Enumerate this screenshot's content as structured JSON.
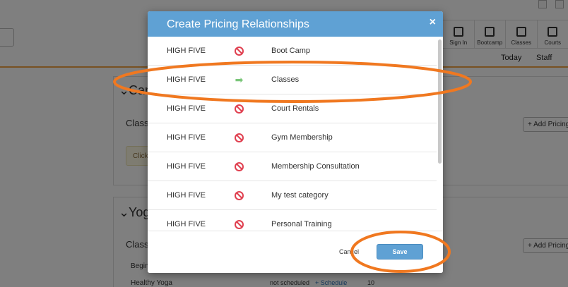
{
  "background": {
    "toolbar": [
      {
        "label": "Sign In",
        "icon": "person-icon"
      },
      {
        "label": "Bootcamp",
        "icon": "calendar-icon"
      },
      {
        "label": "Classes",
        "icon": "calendar-icon"
      },
      {
        "label": "Courts",
        "icon": "calendar-icon"
      }
    ],
    "nav": {
      "today": "Today",
      "staff": "Staff"
    },
    "panel1": {
      "title": "Cam",
      "section": "Class",
      "add_button": "+ Add Pricing",
      "notice": "Click"
    },
    "panel2": {
      "title": "Yog",
      "section": "Class",
      "add_button": "+ Add Pricing",
      "rows": [
        {
          "name": "Begin"
        },
        {
          "name": "Healthy Yoga",
          "status": "not scheduled",
          "action": "+ Schedule",
          "count": "10"
        }
      ]
    }
  },
  "modal": {
    "title": "Create Pricing Relationships",
    "close_label": "×",
    "items": [
      {
        "pricing": "HIGH FIVE",
        "status": "none",
        "category": "Boot Camp"
      },
      {
        "pricing": "HIGH FIVE",
        "status": "linked",
        "category": "Classes"
      },
      {
        "pricing": "HIGH FIVE",
        "status": "none",
        "category": "Court Rentals"
      },
      {
        "pricing": "HIGH FIVE",
        "status": "none",
        "category": "Gym Membership"
      },
      {
        "pricing": "HIGH FIVE",
        "status": "none",
        "category": "Membership Consultation"
      },
      {
        "pricing": "HIGH FIVE",
        "status": "none",
        "category": "My test category"
      },
      {
        "pricing": "HIGH FIVE",
        "status": "none",
        "category": "Personal Training"
      }
    ],
    "cancel_label": "Cancel",
    "save_label": "Save"
  },
  "colors": {
    "header": "#5fa1d4",
    "no_link": "#e04050",
    "link_arrow": "#7bc67a",
    "highlight": "#f07820"
  }
}
